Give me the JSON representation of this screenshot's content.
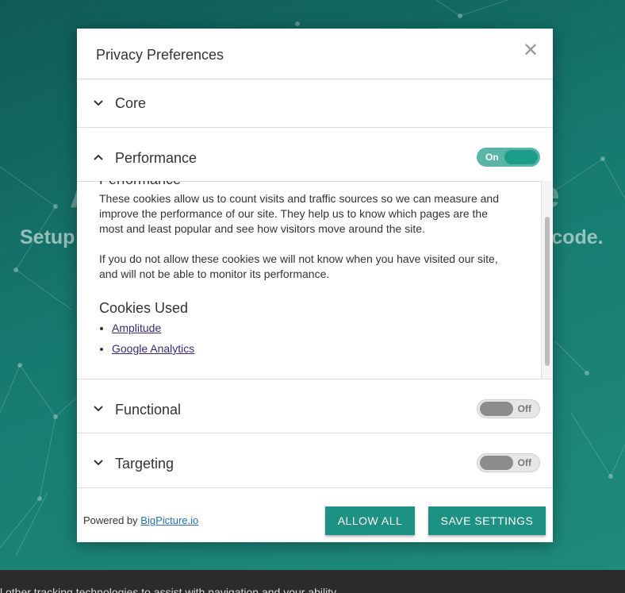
{
  "background": {
    "heading_left": "Setup",
    "heading_right": "f code.",
    "big_fragment_left": "A",
    "big_fragment_right": "e",
    "bottom_text": "l other tracking technologies to assist with navigation and your ability"
  },
  "modal": {
    "title": "Privacy Preferences",
    "close_icon": "close-icon",
    "sections": [
      {
        "label": "Core",
        "expanded": false
      },
      {
        "label": "Performance",
        "expanded": true,
        "toggle": "On"
      },
      {
        "label": "Functional",
        "expanded": false,
        "toggle": "Off"
      },
      {
        "label": "Targeting",
        "expanded": false,
        "toggle": "Off"
      }
    ],
    "performance_detail": {
      "subtitle": "Performance",
      "paragraph1": "These cookies allow us to count visits and traffic sources so we can measure and improve the performance of our site. They help us to know which pages are the most and least popular and see how visitors move around the site.",
      "paragraph2": "If you do not allow these cookies we will not know when you have visited our site, and will not be able to monitor its performance.",
      "cookies_title": "Cookies Used",
      "cookies": [
        "Amplitude",
        "Google Analytics"
      ]
    },
    "footer": {
      "powered_by": "Powered by",
      "powered_link": "BigPicture.io",
      "allow_all": "ALLOW ALL",
      "save_settings": "SAVE SETTINGS"
    }
  },
  "colors": {
    "accent": "#1e9185",
    "toggle_on": "#1e9c8a",
    "toggle_off": "#8c8c8c"
  }
}
